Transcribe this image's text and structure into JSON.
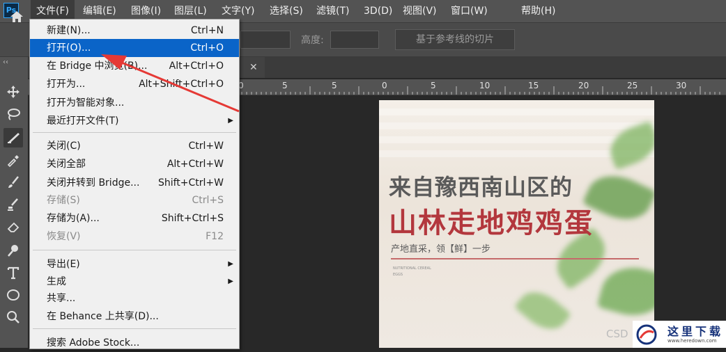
{
  "app": {
    "logo_text": "Ps"
  },
  "menubar": {
    "items": [
      {
        "label": "文件(F)"
      },
      {
        "label": "编辑(E)"
      },
      {
        "label": "图像(I)"
      },
      {
        "label": "图层(L)"
      },
      {
        "label": "文字(Y)"
      },
      {
        "label": "选择(S)"
      },
      {
        "label": "滤镜(T)"
      },
      {
        "label": "3D(D)"
      },
      {
        "label": "视图(V)"
      },
      {
        "label": "窗口(W)"
      },
      {
        "label": "帮助(H)"
      }
    ]
  },
  "options_bar": {
    "height_label": "高度:",
    "slice_button": "基于参考线的切片"
  },
  "ruler": {
    "labels": [
      "0",
      "5",
      "10",
      "5",
      "0",
      "5",
      "10",
      "15",
      "20",
      "25",
      "30"
    ]
  },
  "file_menu": {
    "items": [
      {
        "label": "新建(N)...",
        "shortcut": "Ctrl+N"
      },
      {
        "label": "打开(O)...",
        "shortcut": "Ctrl+O"
      },
      {
        "label": "在 Bridge 中浏览(B)...",
        "shortcut": "Alt+Ctrl+O"
      },
      {
        "label": "打开为...",
        "shortcut": "Alt+Shift+Ctrl+O"
      },
      {
        "label": "打开为智能对象...",
        "shortcut": ""
      },
      {
        "label": "最近打开文件(T)",
        "shortcut": ""
      },
      {
        "label": "关闭(C)",
        "shortcut": "Ctrl+W"
      },
      {
        "label": "关闭全部",
        "shortcut": "Alt+Ctrl+W"
      },
      {
        "label": "关闭并转到 Bridge...",
        "shortcut": "Shift+Ctrl+W"
      },
      {
        "label": "存储(S)",
        "shortcut": "Ctrl+S"
      },
      {
        "label": "存储为(A)...",
        "shortcut": "Shift+Ctrl+S"
      },
      {
        "label": "恢复(V)",
        "shortcut": "F12"
      },
      {
        "label": "导出(E)",
        "shortcut": ""
      },
      {
        "label": "生成",
        "shortcut": ""
      },
      {
        "label": "共享...",
        "shortcut": ""
      },
      {
        "label": "在 Behance 上共享(D)...",
        "shortcut": ""
      },
      {
        "label": "搜索 Adobe Stock...",
        "shortcut": ""
      }
    ]
  },
  "poster": {
    "line1": "来自豫西南山区的",
    "line2": "山林走地鸡鸡蛋",
    "subtitle": "产地直采，领【鲜】一步",
    "tiny1": "NUTRITIONAL CEREAL",
    "tiny2": "EGGS"
  },
  "watermark": {
    "csdn": "CSD",
    "title": "这里下载",
    "url": "www.heredown.com"
  },
  "colors": {
    "highlight": "#0a64c8",
    "poster_red": "#b3373d",
    "annotation_red": "#e53935"
  }
}
